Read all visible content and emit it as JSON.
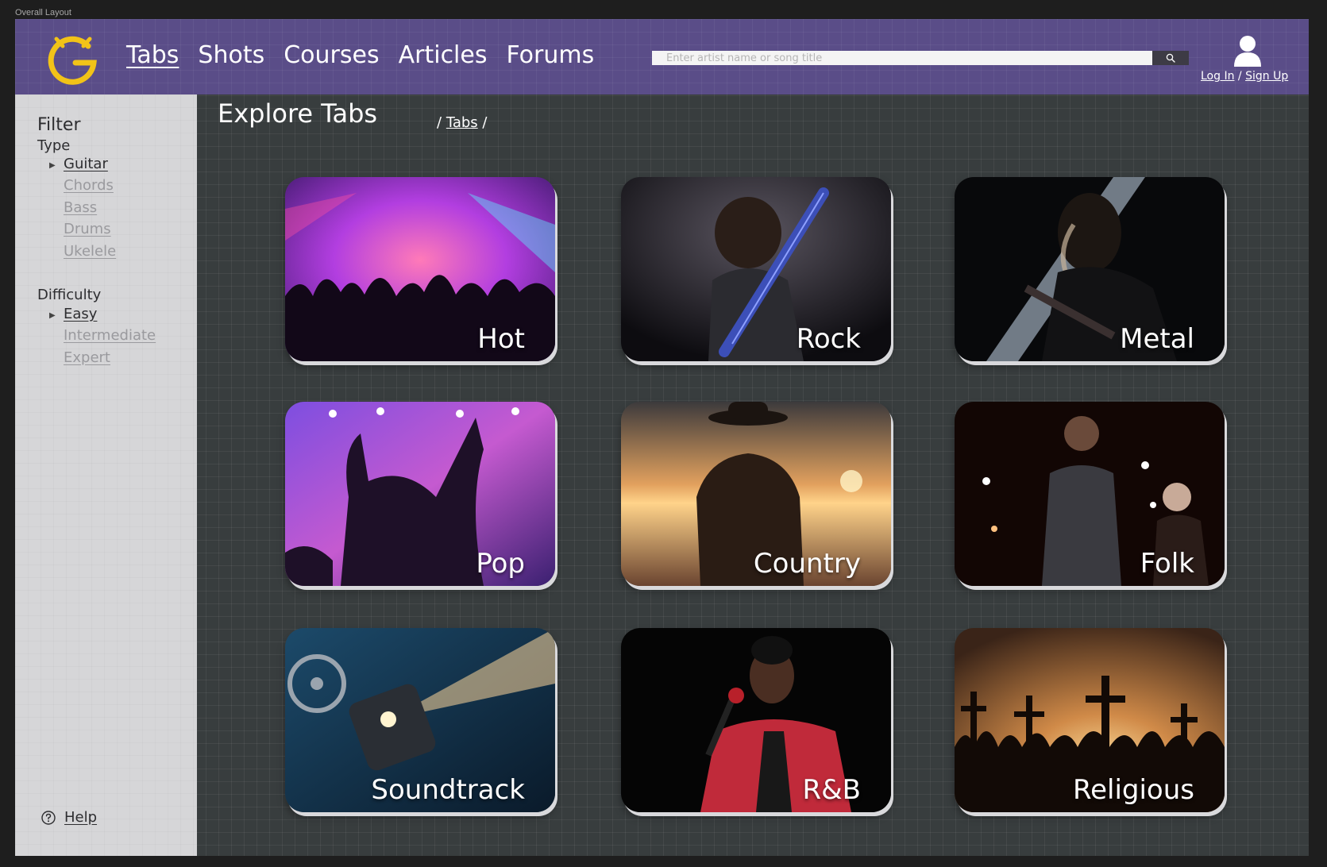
{
  "frame_label": "Overall Layout",
  "header": {
    "nav": [
      {
        "label": "Tabs",
        "active": true
      },
      {
        "label": "Shots",
        "active": false
      },
      {
        "label": "Courses",
        "active": false
      },
      {
        "label": "Articles",
        "active": false
      },
      {
        "label": "Forums",
        "active": false
      }
    ],
    "search": {
      "placeholder": "Enter artist name or song title",
      "value": ""
    },
    "auth": {
      "login": "Log In",
      "separator": "/",
      "signup": "Sign Up"
    }
  },
  "sidebar": {
    "title": "Filter",
    "type": {
      "label": "Type",
      "options": [
        "Guitar",
        "Chords",
        "Bass",
        "Drums",
        "Ukelele"
      ],
      "selected": "Guitar"
    },
    "difficulty": {
      "label": "Difficulty",
      "options": [
        "Easy",
        "Intermediate",
        "Expert"
      ],
      "selected": "Easy"
    },
    "help": "Help"
  },
  "main": {
    "title": "Explore Tabs",
    "breadcrumb": {
      "prefix": "/",
      "link": "Tabs",
      "suffix": "/"
    },
    "genres": [
      {
        "label": "Hot",
        "image": "concert-crowd-purple-lights"
      },
      {
        "label": "Rock",
        "image": "rock-guitarist"
      },
      {
        "label": "Metal",
        "image": "metal-guitarist-spotlight"
      },
      {
        "label": "Pop",
        "image": "pop-concert-crowd"
      },
      {
        "label": "Country",
        "image": "cowboy-sunset-silhouette"
      },
      {
        "label": "Folk",
        "image": "folk-singer-stage"
      },
      {
        "label": "Soundtrack",
        "image": "film-projector-light"
      },
      {
        "label": "R&B",
        "image": "rnb-singer-red-jacket"
      },
      {
        "label": "Religious",
        "image": "crosses-raised-hands-sunset"
      }
    ]
  },
  "colors": {
    "header": "#5a4d88",
    "sidebar": "#d6d6d8",
    "canvas": "#383d3e",
    "logo": "#f2c318"
  }
}
